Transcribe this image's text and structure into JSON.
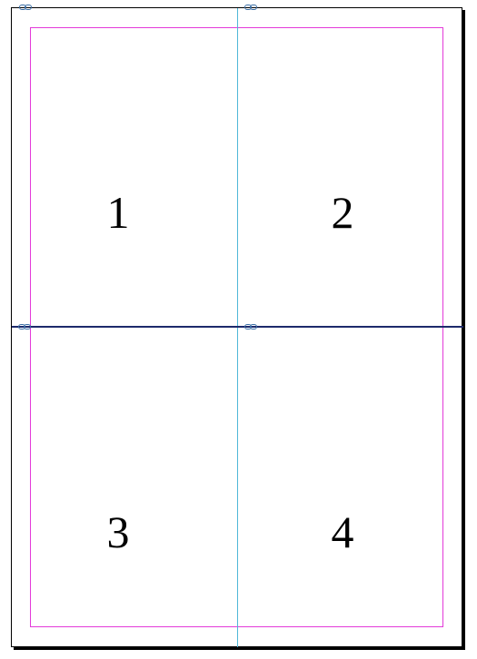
{
  "page": {
    "frames": [
      {
        "label": "1"
      },
      {
        "label": "2"
      },
      {
        "label": "3"
      },
      {
        "label": "4"
      }
    ]
  },
  "colors": {
    "margin_guide": "#e33ad9",
    "column_guide": "#4fb7d8",
    "row_guide": "#1d2a6b",
    "link_icon": "#3a6ea5"
  },
  "icons": [
    "link-icon"
  ]
}
